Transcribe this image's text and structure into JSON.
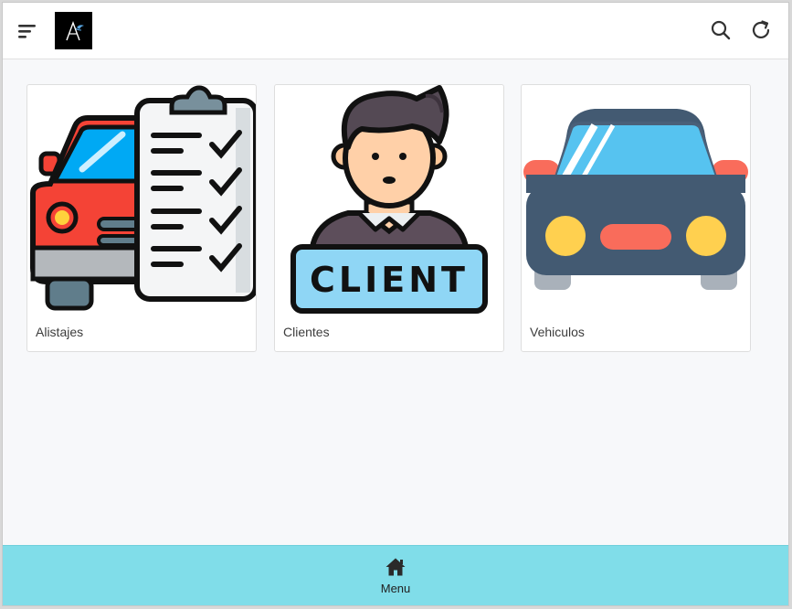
{
  "header": {
    "menu_icon": "hamburger-menu-icon",
    "logo_icon": "brand-logo",
    "search_icon": "search-icon",
    "refresh_icon": "refresh-icon"
  },
  "cards": [
    {
      "label": "Alistajes",
      "icon": "truck-checklist-illustration"
    },
    {
      "label": "Clientes",
      "icon": "client-person-illustration",
      "sign_text": "CLIENT"
    },
    {
      "label": "Vehiculos",
      "icon": "car-front-illustration"
    }
  ],
  "bottom_nav": {
    "menu_label": "Menu",
    "menu_icon": "home-icon"
  },
  "colors": {
    "bottom_bar": "#80dde9",
    "background": "#f7f8fa"
  }
}
